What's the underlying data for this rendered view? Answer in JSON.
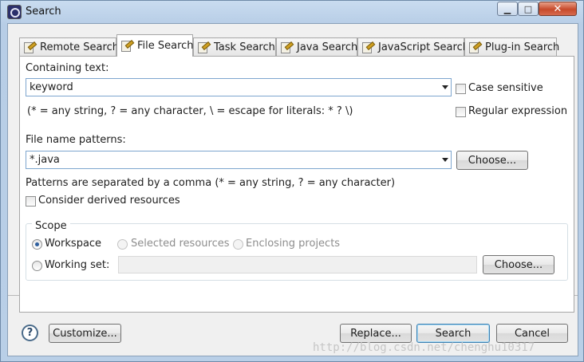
{
  "window": {
    "title": "Search",
    "controls": {
      "minimize": "▁",
      "maximize": "□",
      "close": "✕"
    }
  },
  "tabs": [
    {
      "label": "Remote Search",
      "icon": "remote-search-icon",
      "active": false
    },
    {
      "label": "File Search",
      "icon": "file-search-icon",
      "active": true
    },
    {
      "label": "Task Search",
      "icon": "task-search-icon",
      "active": false
    },
    {
      "label": "Java Search",
      "icon": "java-search-icon",
      "active": false
    },
    {
      "label": "JavaScript Search",
      "icon": "javascript-search-icon",
      "active": false
    },
    {
      "label": "Plug-in Search",
      "icon": "plugin-search-icon",
      "active": false
    }
  ],
  "containing_text": {
    "label": "Containing text:",
    "value": "keyword",
    "hint": "(* = any string, ? = any character, \\ = escape for literals: * ? \\)"
  },
  "options": {
    "case_sensitive": {
      "label": "Case sensitive",
      "checked": false
    },
    "regular_expression": {
      "label": "Regular expression",
      "checked": false
    }
  },
  "file_name_patterns": {
    "label": "File name patterns:",
    "value": "*.java",
    "hint": "Patterns are separated by a comma (* = any string, ? = any character)",
    "choose_label": "Choose..."
  },
  "derived_resources": {
    "label": "Consider derived resources",
    "checked": false
  },
  "scope": {
    "title": "Scope",
    "workspace": {
      "label": "Workspace",
      "checked": true
    },
    "selected_resources": {
      "label": "Selected resources",
      "enabled": false
    },
    "enclosing_projects": {
      "label": "Enclosing projects",
      "enabled": false
    },
    "working_set": {
      "label": "Working set:",
      "value": "",
      "choose_label": "Choose..."
    }
  },
  "footer": {
    "help": "?",
    "customize_label": "Customize...",
    "replace_label": "Replace...",
    "search_label": "Search",
    "cancel_label": "Cancel"
  },
  "watermark": "http://blog.csdn.net/chenghu10317"
}
